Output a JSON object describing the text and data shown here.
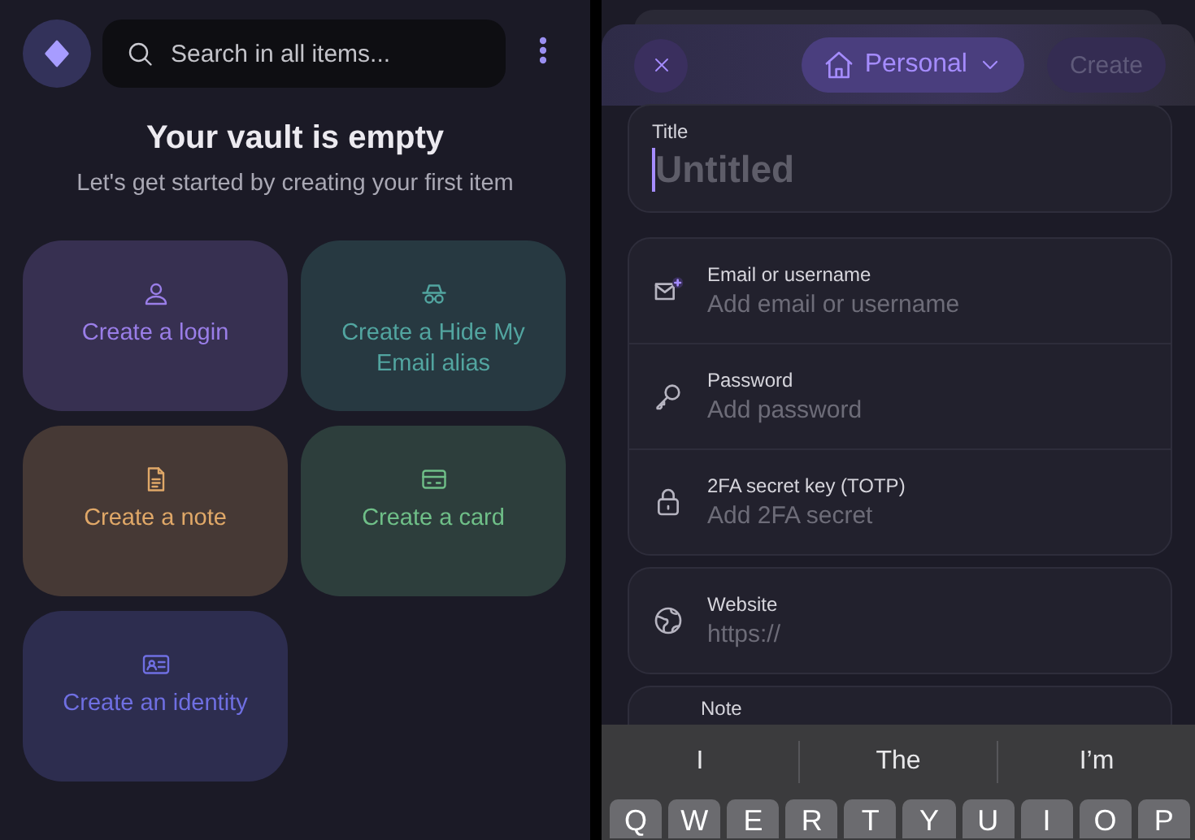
{
  "vault": {
    "search": {
      "placeholder": "Search in all items..."
    },
    "empty_title": "Your vault is empty",
    "empty_subtitle": "Let's get started by creating your first item",
    "create_tiles": [
      {
        "kind": "login",
        "label": "Create a login",
        "color": "#9a7ee8"
      },
      {
        "kind": "alias",
        "label": "Create a Hide My Email alias",
        "color": "#52a5a0"
      },
      {
        "kind": "note",
        "label": "Create a note",
        "color": "#e0a868"
      },
      {
        "kind": "card",
        "label": "Create a card",
        "color": "#6fbf88"
      },
      {
        "kind": "identity",
        "label": "Create an identity",
        "color": "#6f6fe2"
      }
    ]
  },
  "editor": {
    "vault_selector": "Personal",
    "create_button": {
      "label": "Create",
      "disabled": true
    },
    "title_field": {
      "label": "Title",
      "placeholder": "Untitled"
    },
    "login_fields": [
      {
        "kind": "email",
        "label": "Email or username",
        "placeholder": "Add email or username"
      },
      {
        "kind": "password",
        "label": "Password",
        "placeholder": "Add password"
      },
      {
        "kind": "totp",
        "label": "2FA secret key (TOTP)",
        "placeholder": "Add 2FA secret"
      }
    ],
    "website_field": {
      "label": "Website",
      "placeholder": "https://"
    },
    "note_label": "Note"
  },
  "keyboard": {
    "suggestions": [
      "I",
      "The",
      "I’m"
    ],
    "keys": [
      "Q",
      "W",
      "E",
      "R",
      "T",
      "Y",
      "U",
      "I",
      "O",
      "P"
    ]
  }
}
